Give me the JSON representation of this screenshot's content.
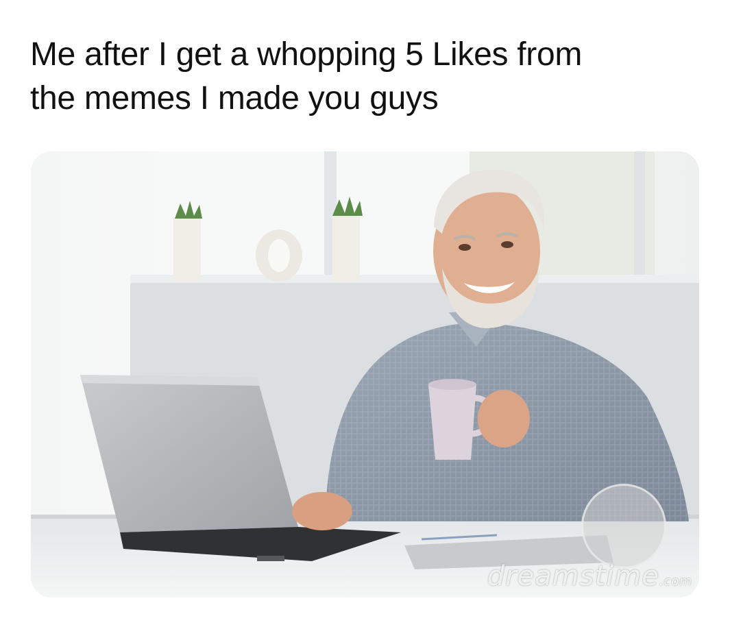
{
  "meme": {
    "caption_line_1": "Me after I get a whopping 5 Likes from",
    "caption_line_2": "the memes I made you guys"
  },
  "photo": {
    "watermark_text": "dreamstime",
    "watermark_tld": ".com"
  },
  "colors": {
    "background": "#ffffff",
    "caption_text": "#111111",
    "wall": "#e9ebec",
    "shirt": "#8e9bab",
    "laptop": "#b9bcbf"
  }
}
